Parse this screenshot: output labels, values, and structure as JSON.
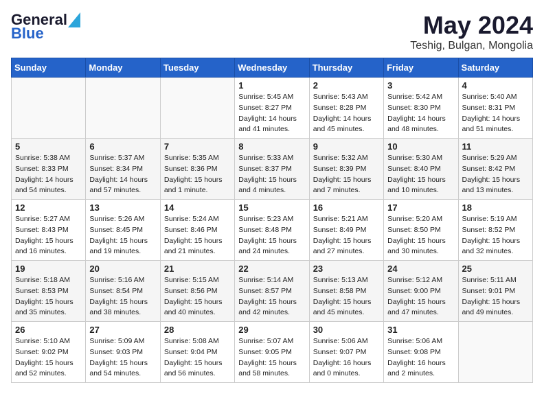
{
  "header": {
    "logo_text_general": "General",
    "logo_text_blue": "Blue",
    "month_title": "May 2024",
    "location": "Teshig, Bulgan, Mongolia"
  },
  "weekdays": [
    "Sunday",
    "Monday",
    "Tuesday",
    "Wednesday",
    "Thursday",
    "Friday",
    "Saturday"
  ],
  "weeks": [
    [
      {
        "day": "",
        "sunrise": "",
        "sunset": "",
        "daylight": ""
      },
      {
        "day": "",
        "sunrise": "",
        "sunset": "",
        "daylight": ""
      },
      {
        "day": "",
        "sunrise": "",
        "sunset": "",
        "daylight": ""
      },
      {
        "day": "1",
        "sunrise": "Sunrise: 5:45 AM",
        "sunset": "Sunset: 8:27 PM",
        "daylight": "Daylight: 14 hours and 41 minutes."
      },
      {
        "day": "2",
        "sunrise": "Sunrise: 5:43 AM",
        "sunset": "Sunset: 8:28 PM",
        "daylight": "Daylight: 14 hours and 45 minutes."
      },
      {
        "day": "3",
        "sunrise": "Sunrise: 5:42 AM",
        "sunset": "Sunset: 8:30 PM",
        "daylight": "Daylight: 14 hours and 48 minutes."
      },
      {
        "day": "4",
        "sunrise": "Sunrise: 5:40 AM",
        "sunset": "Sunset: 8:31 PM",
        "daylight": "Daylight: 14 hours and 51 minutes."
      }
    ],
    [
      {
        "day": "5",
        "sunrise": "Sunrise: 5:38 AM",
        "sunset": "Sunset: 8:33 PM",
        "daylight": "Daylight: 14 hours and 54 minutes."
      },
      {
        "day": "6",
        "sunrise": "Sunrise: 5:37 AM",
        "sunset": "Sunset: 8:34 PM",
        "daylight": "Daylight: 14 hours and 57 minutes."
      },
      {
        "day": "7",
        "sunrise": "Sunrise: 5:35 AM",
        "sunset": "Sunset: 8:36 PM",
        "daylight": "Daylight: 15 hours and 1 minute."
      },
      {
        "day": "8",
        "sunrise": "Sunrise: 5:33 AM",
        "sunset": "Sunset: 8:37 PM",
        "daylight": "Daylight: 15 hours and 4 minutes."
      },
      {
        "day": "9",
        "sunrise": "Sunrise: 5:32 AM",
        "sunset": "Sunset: 8:39 PM",
        "daylight": "Daylight: 15 hours and 7 minutes."
      },
      {
        "day": "10",
        "sunrise": "Sunrise: 5:30 AM",
        "sunset": "Sunset: 8:40 PM",
        "daylight": "Daylight: 15 hours and 10 minutes."
      },
      {
        "day": "11",
        "sunrise": "Sunrise: 5:29 AM",
        "sunset": "Sunset: 8:42 PM",
        "daylight": "Daylight: 15 hours and 13 minutes."
      }
    ],
    [
      {
        "day": "12",
        "sunrise": "Sunrise: 5:27 AM",
        "sunset": "Sunset: 8:43 PM",
        "daylight": "Daylight: 15 hours and 16 minutes."
      },
      {
        "day": "13",
        "sunrise": "Sunrise: 5:26 AM",
        "sunset": "Sunset: 8:45 PM",
        "daylight": "Daylight: 15 hours and 19 minutes."
      },
      {
        "day": "14",
        "sunrise": "Sunrise: 5:24 AM",
        "sunset": "Sunset: 8:46 PM",
        "daylight": "Daylight: 15 hours and 21 minutes."
      },
      {
        "day": "15",
        "sunrise": "Sunrise: 5:23 AM",
        "sunset": "Sunset: 8:48 PM",
        "daylight": "Daylight: 15 hours and 24 minutes."
      },
      {
        "day": "16",
        "sunrise": "Sunrise: 5:21 AM",
        "sunset": "Sunset: 8:49 PM",
        "daylight": "Daylight: 15 hours and 27 minutes."
      },
      {
        "day": "17",
        "sunrise": "Sunrise: 5:20 AM",
        "sunset": "Sunset: 8:50 PM",
        "daylight": "Daylight: 15 hours and 30 minutes."
      },
      {
        "day": "18",
        "sunrise": "Sunrise: 5:19 AM",
        "sunset": "Sunset: 8:52 PM",
        "daylight": "Daylight: 15 hours and 32 minutes."
      }
    ],
    [
      {
        "day": "19",
        "sunrise": "Sunrise: 5:18 AM",
        "sunset": "Sunset: 8:53 PM",
        "daylight": "Daylight: 15 hours and 35 minutes."
      },
      {
        "day": "20",
        "sunrise": "Sunrise: 5:16 AM",
        "sunset": "Sunset: 8:54 PM",
        "daylight": "Daylight: 15 hours and 38 minutes."
      },
      {
        "day": "21",
        "sunrise": "Sunrise: 5:15 AM",
        "sunset": "Sunset: 8:56 PM",
        "daylight": "Daylight: 15 hours and 40 minutes."
      },
      {
        "day": "22",
        "sunrise": "Sunrise: 5:14 AM",
        "sunset": "Sunset: 8:57 PM",
        "daylight": "Daylight: 15 hours and 42 minutes."
      },
      {
        "day": "23",
        "sunrise": "Sunrise: 5:13 AM",
        "sunset": "Sunset: 8:58 PM",
        "daylight": "Daylight: 15 hours and 45 minutes."
      },
      {
        "day": "24",
        "sunrise": "Sunrise: 5:12 AM",
        "sunset": "Sunset: 9:00 PM",
        "daylight": "Daylight: 15 hours and 47 minutes."
      },
      {
        "day": "25",
        "sunrise": "Sunrise: 5:11 AM",
        "sunset": "Sunset: 9:01 PM",
        "daylight": "Daylight: 15 hours and 49 minutes."
      }
    ],
    [
      {
        "day": "26",
        "sunrise": "Sunrise: 5:10 AM",
        "sunset": "Sunset: 9:02 PM",
        "daylight": "Daylight: 15 hours and 52 minutes."
      },
      {
        "day": "27",
        "sunrise": "Sunrise: 5:09 AM",
        "sunset": "Sunset: 9:03 PM",
        "daylight": "Daylight: 15 hours and 54 minutes."
      },
      {
        "day": "28",
        "sunrise": "Sunrise: 5:08 AM",
        "sunset": "Sunset: 9:04 PM",
        "daylight": "Daylight: 15 hours and 56 minutes."
      },
      {
        "day": "29",
        "sunrise": "Sunrise: 5:07 AM",
        "sunset": "Sunset: 9:05 PM",
        "daylight": "Daylight: 15 hours and 58 minutes."
      },
      {
        "day": "30",
        "sunrise": "Sunrise: 5:06 AM",
        "sunset": "Sunset: 9:07 PM",
        "daylight": "Daylight: 16 hours and 0 minutes."
      },
      {
        "day": "31",
        "sunrise": "Sunrise: 5:06 AM",
        "sunset": "Sunset: 9:08 PM",
        "daylight": "Daylight: 16 hours and 2 minutes."
      },
      {
        "day": "",
        "sunrise": "",
        "sunset": "",
        "daylight": ""
      }
    ]
  ]
}
